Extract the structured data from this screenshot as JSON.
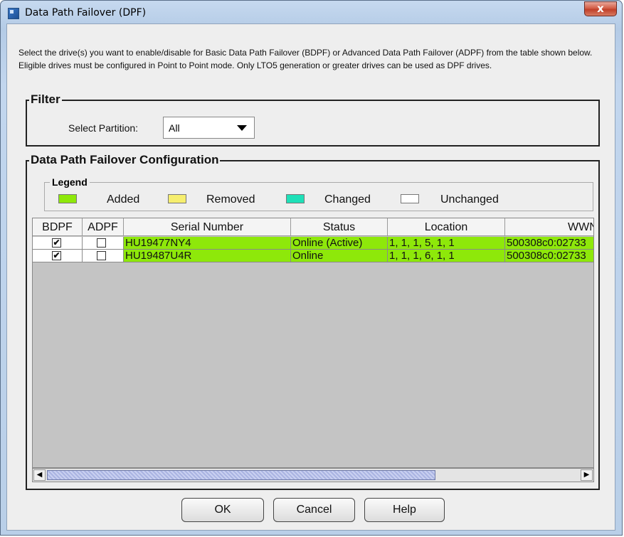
{
  "window": {
    "title": "Data Path Failover (DPF)",
    "close_label": "x"
  },
  "description": "Select the drive(s) you want to enable/disable for Basic Data Path Failover (BDPF) or Advanced Data Path Failover (ADPF) from the table shown below. Eligible drives must be configured in Point to Point mode. Only LTO5 generation or greater drives can be used as DPF drives.",
  "filter": {
    "group_label": "Filter",
    "select_label": "Select Partition:",
    "selected_value": "All"
  },
  "config": {
    "group_label": "Data Path Failover Configuration"
  },
  "legend": {
    "label": "Legend",
    "items": [
      {
        "label": "Added",
        "color": "#8ee80a"
      },
      {
        "label": "Removed",
        "color": "#f6ee6e"
      },
      {
        "label": "Changed",
        "color": "#1ee0b8"
      },
      {
        "label": "Unchanged",
        "color": "#ffffff"
      }
    ]
  },
  "table": {
    "columns": [
      "BDPF",
      "ADPF",
      "Serial Number",
      "Status",
      "Location",
      "WWN"
    ],
    "row_color": "#8ee80a",
    "rows": [
      {
        "bdpf": true,
        "adpf": false,
        "serial": "HU19477NY4",
        "status": "Online (Active)",
        "location": "1, 1, 1, 5, 1, 1",
        "wwn": "500308c0:02733"
      },
      {
        "bdpf": true,
        "adpf": false,
        "serial": "HU19487U4R",
        "status": "Online",
        "location": "1, 1, 1, 6, 1, 1",
        "wwn": "500308c0:02733"
      }
    ]
  },
  "buttons": {
    "ok": "OK",
    "cancel": "Cancel",
    "help": "Help"
  }
}
